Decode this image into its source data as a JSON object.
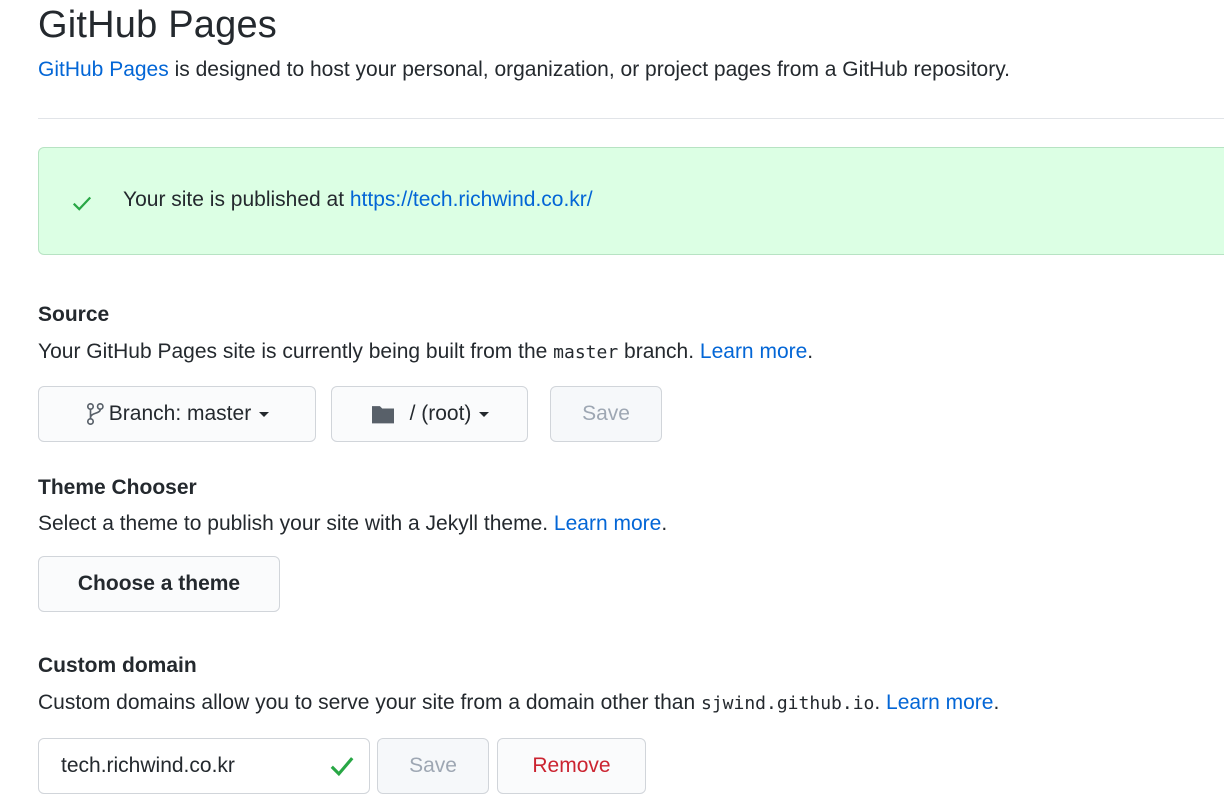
{
  "header": {
    "title": "GitHub Pages",
    "intro_link": "GitHub Pages",
    "intro_text": " is designed to host your personal, organization, or project pages from a GitHub repository."
  },
  "flash": {
    "message": "Your site is published at ",
    "url": "https://tech.richwind.co.kr/",
    "icon": "check-icon"
  },
  "source": {
    "heading": "Source",
    "desc_before": "Your GitHub Pages site is currently being built from the ",
    "branch_code": "master",
    "desc_after": " branch. ",
    "learn_more": "Learn more",
    "period": ".",
    "branch_button": "Branch: master",
    "folder_button": "/ (root)",
    "save_button": "Save"
  },
  "theme": {
    "heading": "Theme Chooser",
    "desc": "Select a theme to publish your site with a Jekyll theme. ",
    "learn_more": "Learn more",
    "period": ".",
    "button": "Choose a theme"
  },
  "custom_domain": {
    "heading": "Custom domain",
    "desc_before": "Custom domains allow you to serve your site from a domain other than ",
    "domain_code": "sjwind.github.io",
    "desc_after": ". ",
    "learn_more": "Learn more",
    "period": ".",
    "input_value": "tech.richwind.co.kr",
    "save_button": "Save",
    "remove_button": "Remove"
  },
  "colors": {
    "link": "#0366d6",
    "success": "#28a745",
    "danger": "#cb2431",
    "flash_bg": "#dcffe4"
  }
}
